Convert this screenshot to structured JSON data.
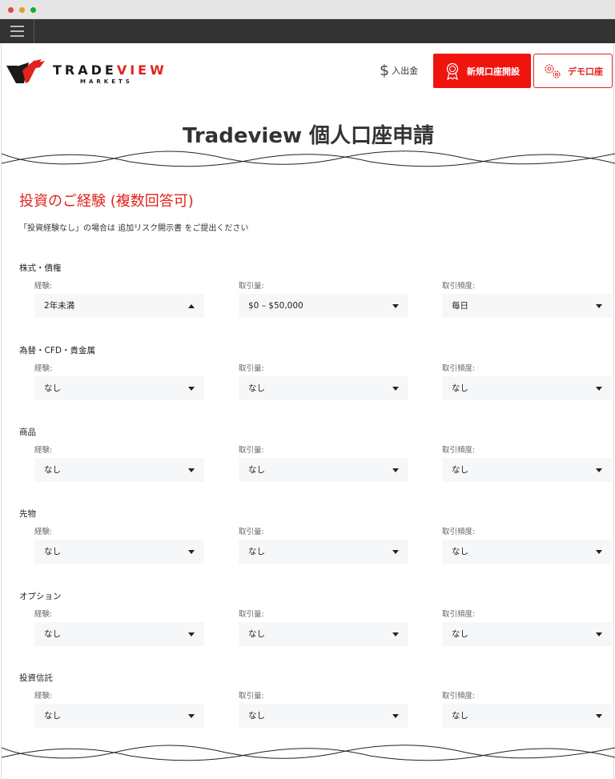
{
  "header": {
    "logo_brand_a": "TRADE",
    "logo_brand_b": "VIEW",
    "logo_sub": "MARKETS",
    "deposit_symbol": "$",
    "deposit_label": "入出金",
    "open_account_label": "新規口座開設",
    "demo_account_label": "デモ口座",
    "accent_color": "#f0140f"
  },
  "page": {
    "title": "Tradeview 個人口座申請"
  },
  "section": {
    "title": "投資のご経験 (複数回答可)",
    "note": "「投資経験なし」の場合は 追加リスク開示書 をご提出ください"
  },
  "field_labels": {
    "experience": "経験:",
    "volume": "取引量:",
    "frequency": "取引頻度:"
  },
  "groups": [
    {
      "label": "株式・債権",
      "experience": "2年未満",
      "volume": "$0 – $50,000",
      "frequency": "毎日",
      "experience_open": true
    },
    {
      "label": "為替・CFD・貴金属",
      "experience": "なし",
      "volume": "なし",
      "frequency": "なし"
    },
    {
      "label": "商品",
      "experience": "なし",
      "volume": "なし",
      "frequency": "なし"
    },
    {
      "label": "先物",
      "experience": "なし",
      "volume": "なし",
      "frequency": "なし"
    },
    {
      "label": "オプション",
      "experience": "なし",
      "volume": "なし",
      "frequency": "なし"
    },
    {
      "label": "投資信託",
      "experience": "なし",
      "volume": "なし",
      "frequency": "なし"
    }
  ]
}
